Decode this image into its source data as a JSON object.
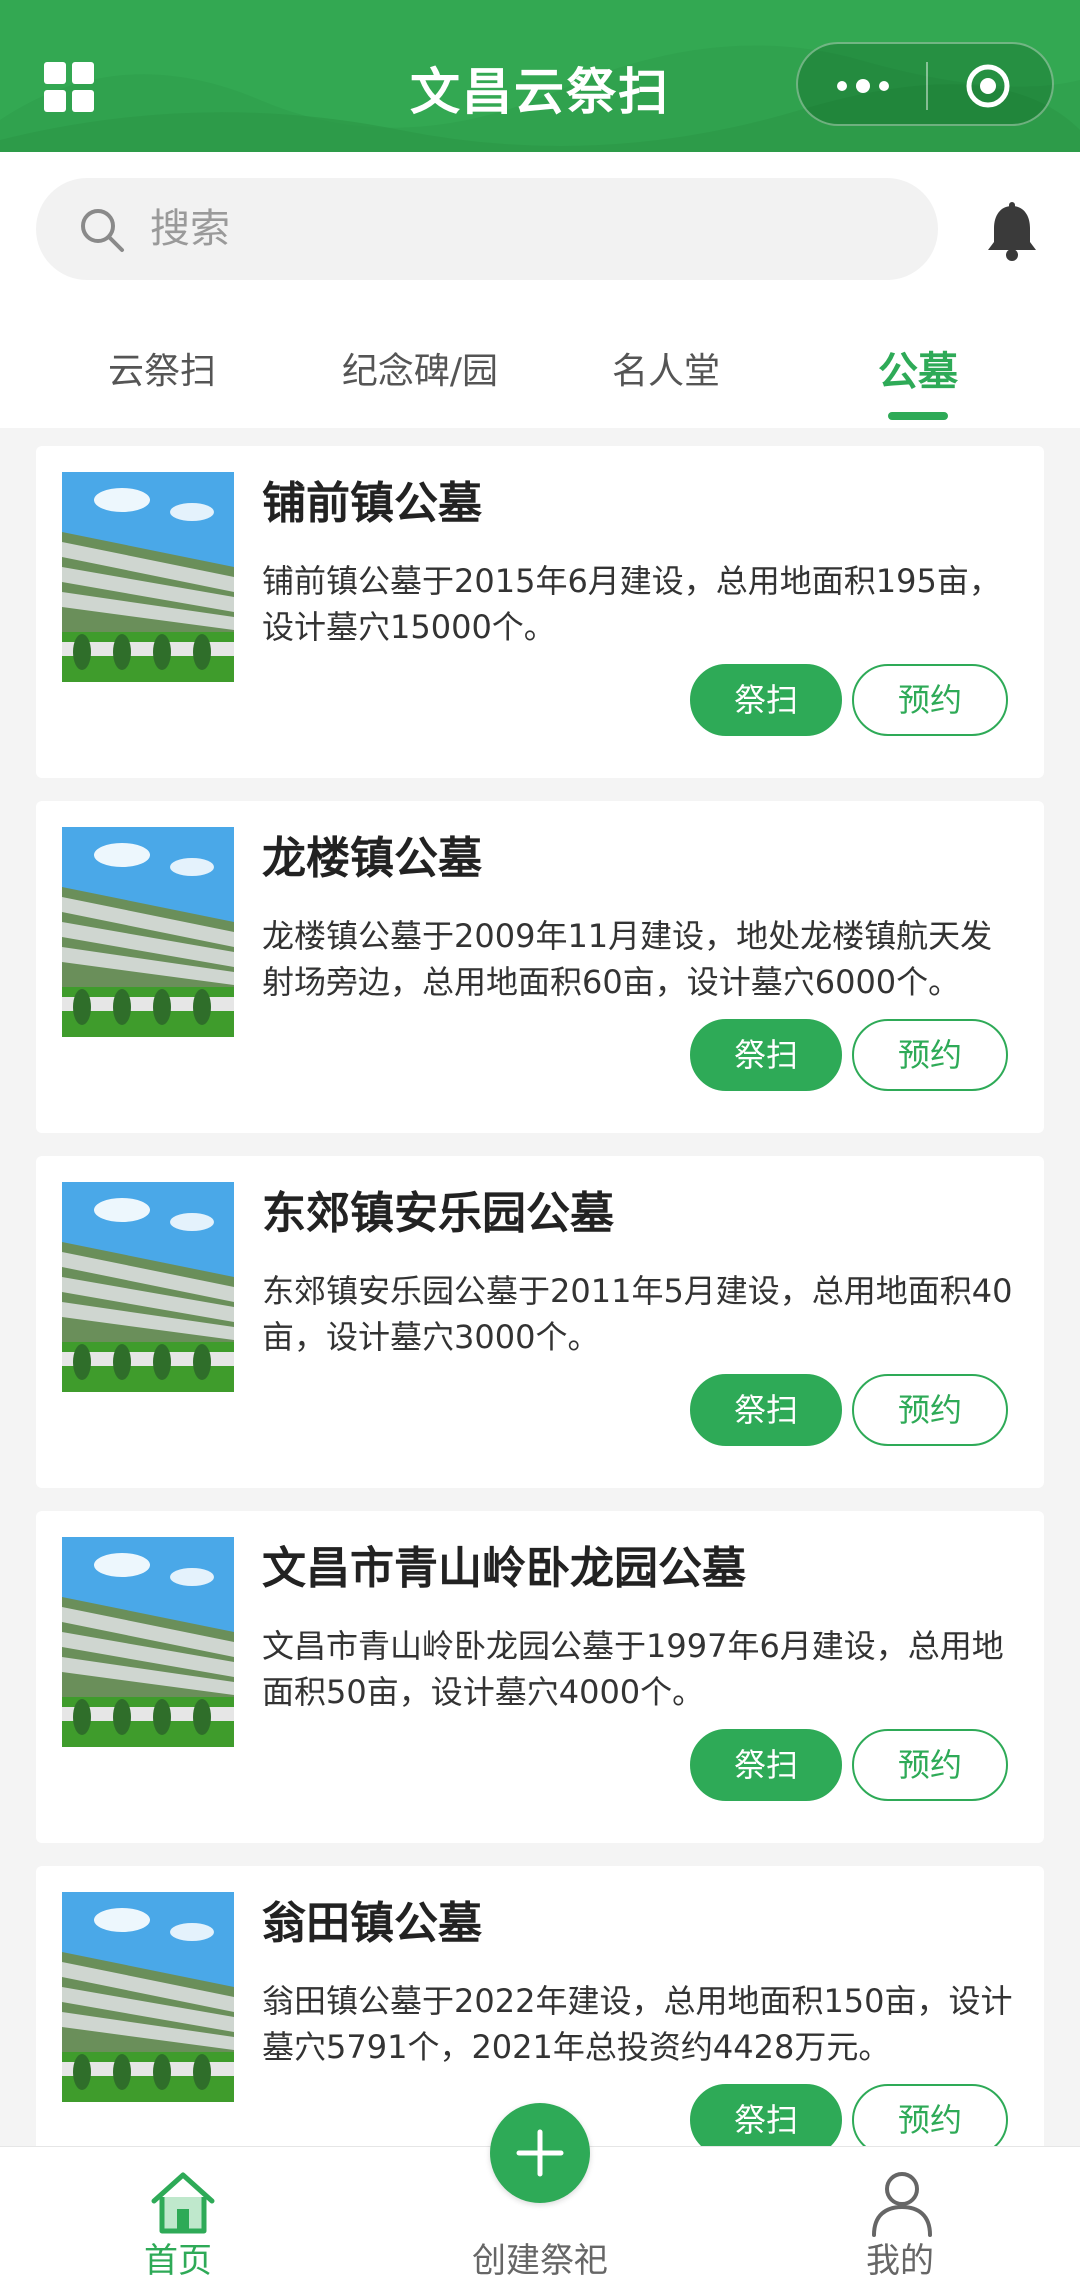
{
  "header": {
    "title": "文昌云祭扫"
  },
  "search": {
    "placeholder": "搜索"
  },
  "tabs": [
    {
      "label": "云祭扫",
      "active": false
    },
    {
      "label": "纪念碑/园",
      "active": false
    },
    {
      "label": "名人堂",
      "active": false
    },
    {
      "label": "公墓",
      "active": true
    }
  ],
  "cards": [
    {
      "title": "铺前镇公墓",
      "desc": "铺前镇公墓于2015年6月建设，总用地面积195亩，设计墓穴15000个。",
      "primary_label": "祭扫",
      "secondary_label": "预约"
    },
    {
      "title": "龙楼镇公墓",
      "desc": "龙楼镇公墓于2009年11月建设，地处龙楼镇航天发射场旁边，总用地面积60亩，设计墓穴6000个。",
      "primary_label": "祭扫",
      "secondary_label": "预约"
    },
    {
      "title": "东郊镇安乐园公墓",
      "desc": "东郊镇安乐园公墓于2011年5月建设，总用地面积40亩，设计墓穴3000个。",
      "primary_label": "祭扫",
      "secondary_label": "预约"
    },
    {
      "title": "文昌市青山岭卧龙园公墓",
      "desc": "文昌市青山岭卧龙园公墓于1997年6月建设，总用地面积50亩，设计墓穴4000个。",
      "primary_label": "祭扫",
      "secondary_label": "预约"
    },
    {
      "title": "翁田镇公墓",
      "desc": "翁田镇公墓于2022年建设，总用地面积150亩，设计墓穴5791个，2021年总投资约4428万元。",
      "primary_label": "祭扫",
      "secondary_label": "预约"
    }
  ],
  "bottom_nav": [
    {
      "label": "首页",
      "icon": "home-icon",
      "active": true
    },
    {
      "label": "创建祭祀",
      "icon": "plus-icon",
      "active": false
    },
    {
      "label": "我的",
      "icon": "user-icon",
      "active": false
    }
  ],
  "colors": {
    "brand": "#33a852",
    "accent": "#2eaa57"
  }
}
